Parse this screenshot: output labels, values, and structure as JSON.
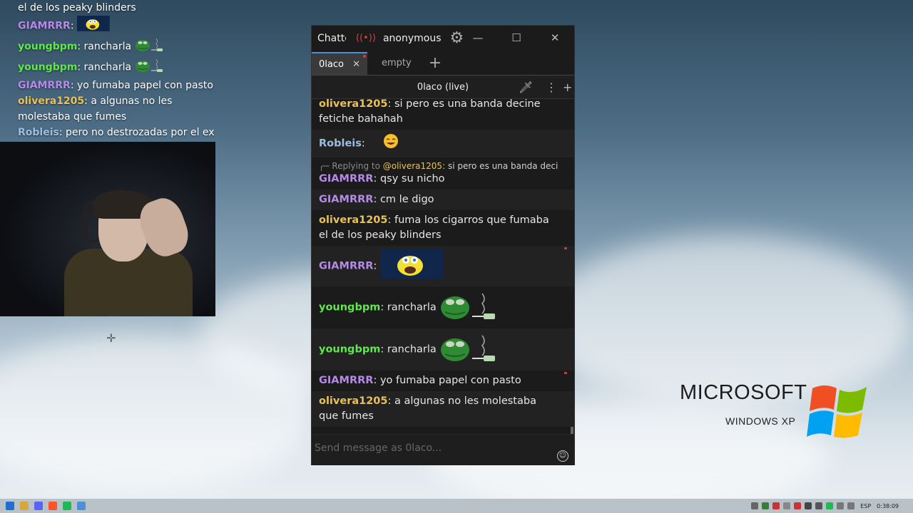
{
  "overlay": {
    "lines": [
      {
        "user": "",
        "user_color": "#ffffff",
        "text": "el de los peaky blinders",
        "emote": null
      },
      {
        "user": "GIAMRRR",
        "user_color": "#b58ae6",
        "text": "",
        "emote": "spongebob-emote"
      },
      {
        "user": "youngbpm",
        "user_color": "#5eea4a",
        "text": "rancharla",
        "emote": "pepe-smoke-emote"
      },
      {
        "user": "youngbpm",
        "user_color": "#5eea4a",
        "text": "rancharla",
        "emote": "pepe-smoke-emote"
      },
      {
        "user": "GIAMRRR",
        "user_color": "#b58ae6",
        "text": "yo fumaba papel con pasto",
        "emote": null
      },
      {
        "user": "olivera1205",
        "user_color": "#e8c157",
        "text": "a algunas no les molestaba que fumes",
        "emote": null
      },
      {
        "user": "Robleis",
        "user_color": "#9bbde0",
        "text": "pero no destrozadas por el ex",
        "emote": null
      }
    ]
  },
  "window": {
    "app_name": "Chatterino",
    "account": "anonymous",
    "tabs": [
      {
        "label": "0laco",
        "active": true
      },
      {
        "label": "empty",
        "active": false
      }
    ],
    "split_title": "0laco (live)",
    "input_placeholder": "Send message as 0laco..."
  },
  "messages": [
    {
      "user": "olivera1205",
      "user_color": "#e8c157",
      "text": "si pero es una banda decine fetiche bahahah",
      "emote": null,
      "reply": null,
      "alt": false,
      "mark": false
    },
    {
      "user": "Robleis",
      "user_color": "#9bbde0",
      "text": "",
      "emote": "laugh-emote",
      "reply": null,
      "alt": true,
      "mark": false
    },
    {
      "user": "GIAMRRR",
      "user_color": "#b58ae6",
      "text": "qsy su nicho",
      "emote": null,
      "reply": {
        "prefix": "Replying to",
        "name": "@olivera1205:",
        "text": "si pero es una banda decir..."
      },
      "alt": false,
      "mark": false
    },
    {
      "user": "GIAMRRR",
      "user_color": "#b58ae6",
      "text": "cm le digo",
      "emote": null,
      "reply": null,
      "alt": true,
      "mark": false
    },
    {
      "user": "olivera1205",
      "user_color": "#e8c157",
      "text": "fuma los cigarros que fumaba el de los peaky blinders",
      "emote": null,
      "reply": null,
      "alt": false,
      "mark": false
    },
    {
      "user": "GIAMRRR",
      "user_color": "#b58ae6",
      "text": "",
      "emote": "spongebob-emote",
      "reply": null,
      "alt": true,
      "mark": true
    },
    {
      "user": "youngbpm",
      "user_color": "#5eea4a",
      "text": "rancharla",
      "emote": "pepe-smoke-emote",
      "reply": null,
      "alt": false,
      "mark": false
    },
    {
      "user": "youngbpm",
      "user_color": "#5eea4a",
      "text": "rancharla",
      "emote": "pepe-smoke-emote",
      "reply": null,
      "alt": true,
      "mark": false
    },
    {
      "user": "GIAMRRR",
      "user_color": "#b58ae6",
      "text": "yo fumaba papel con pasto",
      "emote": null,
      "reply": null,
      "alt": false,
      "mark": true
    },
    {
      "user": "olivera1205",
      "user_color": "#e8c157",
      "text": "a algunas no les molestaba que fumes",
      "emote": null,
      "reply": null,
      "alt": true,
      "mark": false
    },
    {
      "user": "Robleis",
      "user_color": "#9bbde0",
      "text": "pero no destrozadas por el ex",
      "emote": null,
      "reply": null,
      "alt": false,
      "mark": false
    }
  ],
  "desktop": {
    "xp_title": "MICROSOFT",
    "xp_subtitle": "WINDOWS XP"
  },
  "taskbar": {
    "language": "ESP",
    "clock": "0:38:09"
  }
}
